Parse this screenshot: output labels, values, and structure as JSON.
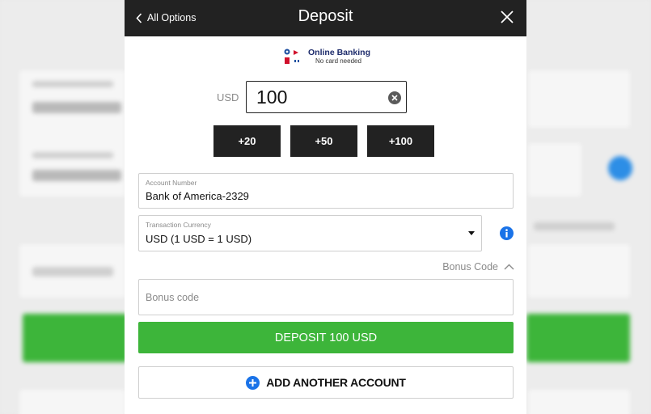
{
  "header": {
    "back_label": "All Options",
    "title": "Deposit"
  },
  "payment_method": {
    "name": "Online Banking",
    "subtitle": "No card needed"
  },
  "amount": {
    "currency": "USD",
    "value": "100"
  },
  "quick_amounts": [
    "+20",
    "+50",
    "+100"
  ],
  "account_number": {
    "label": "Account Number",
    "value": "Bank of America-2329"
  },
  "transaction_currency": {
    "label": "Transaction Currency",
    "value": "USD (1 USD = 1 USD)"
  },
  "bonus": {
    "toggle_label": "Bonus Code",
    "placeholder": "Bonus code"
  },
  "deposit_button": "DEPOSIT 100 USD",
  "add_account_button": "ADD ANOTHER ACCOUNT",
  "colors": {
    "header": "#222222",
    "primary_green": "#3db53a",
    "info_blue": "#1a73e8"
  }
}
